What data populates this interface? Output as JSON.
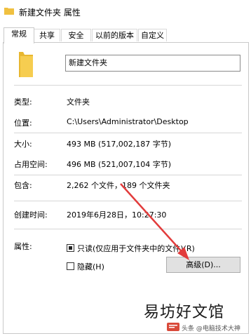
{
  "window": {
    "title": "新建文件夹 属性"
  },
  "tabs": [
    {
      "label": "常规",
      "active": true
    },
    {
      "label": "共享",
      "active": false
    },
    {
      "label": "安全",
      "active": false
    },
    {
      "label": "以前的版本",
      "active": false
    },
    {
      "label": "自定义",
      "active": false
    }
  ],
  "folder_name": "新建文件夹",
  "properties": {
    "type_label": "类型:",
    "type_value": "文件夹",
    "location_label": "位置:",
    "location_value": "C:\\Users\\Administrator\\Desktop",
    "size_label": "大小:",
    "size_value": "493 MB (517,002,187 字节)",
    "disk_label": "占用空间:",
    "disk_value": "496 MB (521,007,104 字节)",
    "contains_label": "包含:",
    "contains_value": "2,262 个文件，189 个文件夹",
    "created_label": "创建时间:",
    "created_value": "2019年6月28日，10:27:30",
    "attributes_label": "属性:"
  },
  "attributes": {
    "readonly_label": "只读(仅应用于文件夹中的文件)(R)",
    "readonly_state": "indeterminate",
    "hidden_label": "隐藏(H)",
    "hidden_state": "unchecked",
    "advanced_button": "高级(D)..."
  },
  "watermark": {
    "main": "易坊好文馆",
    "sub": "头条 @电脑技术大神"
  },
  "colors": {
    "arrow": "#e23c3c",
    "folder": "#f0c040"
  }
}
